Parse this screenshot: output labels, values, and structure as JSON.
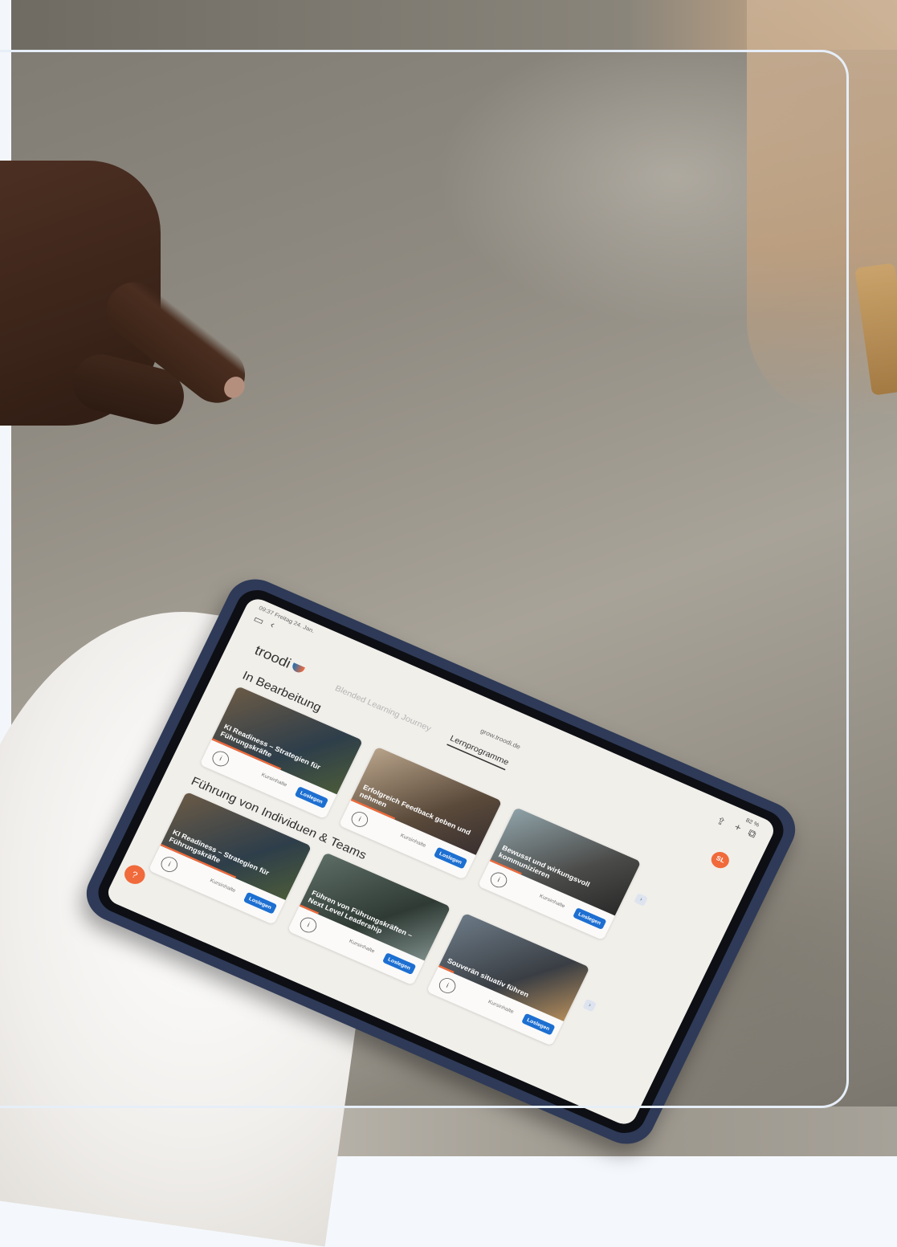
{
  "device": {
    "status_time": "09:37 Freitag 24. Jan.",
    "status_battery": "82 %",
    "url": "grow.troodi.de"
  },
  "app": {
    "logo": "troodi",
    "nav_inactive": "Blended Learning Journey",
    "nav_active": "Lernprogramme",
    "user_initials": "SL"
  },
  "sections": [
    {
      "title": "In Bearbeitung",
      "cards": [
        {
          "title": "KI Readiness – Strategien für Führungskräfte",
          "contents": "Kursinhalte",
          "action": "Loslegen",
          "progress": 0.55
        },
        {
          "title": "Erfolgreich Feedback geben und nehmen",
          "contents": "Kursinhalte",
          "action": "Loslegen",
          "progress": 0.35
        },
        {
          "title": "Bewusst und wirkungsvoll kommunizieren",
          "contents": "Kursinhalte",
          "action": "Loslegen",
          "progress": 0.25
        }
      ]
    },
    {
      "title": "Führung von Individuen & Teams",
      "cards": [
        {
          "title": "KI Readiness – Strategien für Führungskräfte",
          "contents": "Kursinhalte",
          "action": "Loslegen",
          "progress": 0.6
        },
        {
          "title": "Führen von Führungskräften – Next Level Leadership",
          "contents": "Kursinhalte",
          "action": "Loslegen",
          "progress": 0.15
        },
        {
          "title": "Souverän situativ führen",
          "contents": "Kursinhalte",
          "action": "Loslegen",
          "progress": 0.12
        }
      ]
    }
  ]
}
